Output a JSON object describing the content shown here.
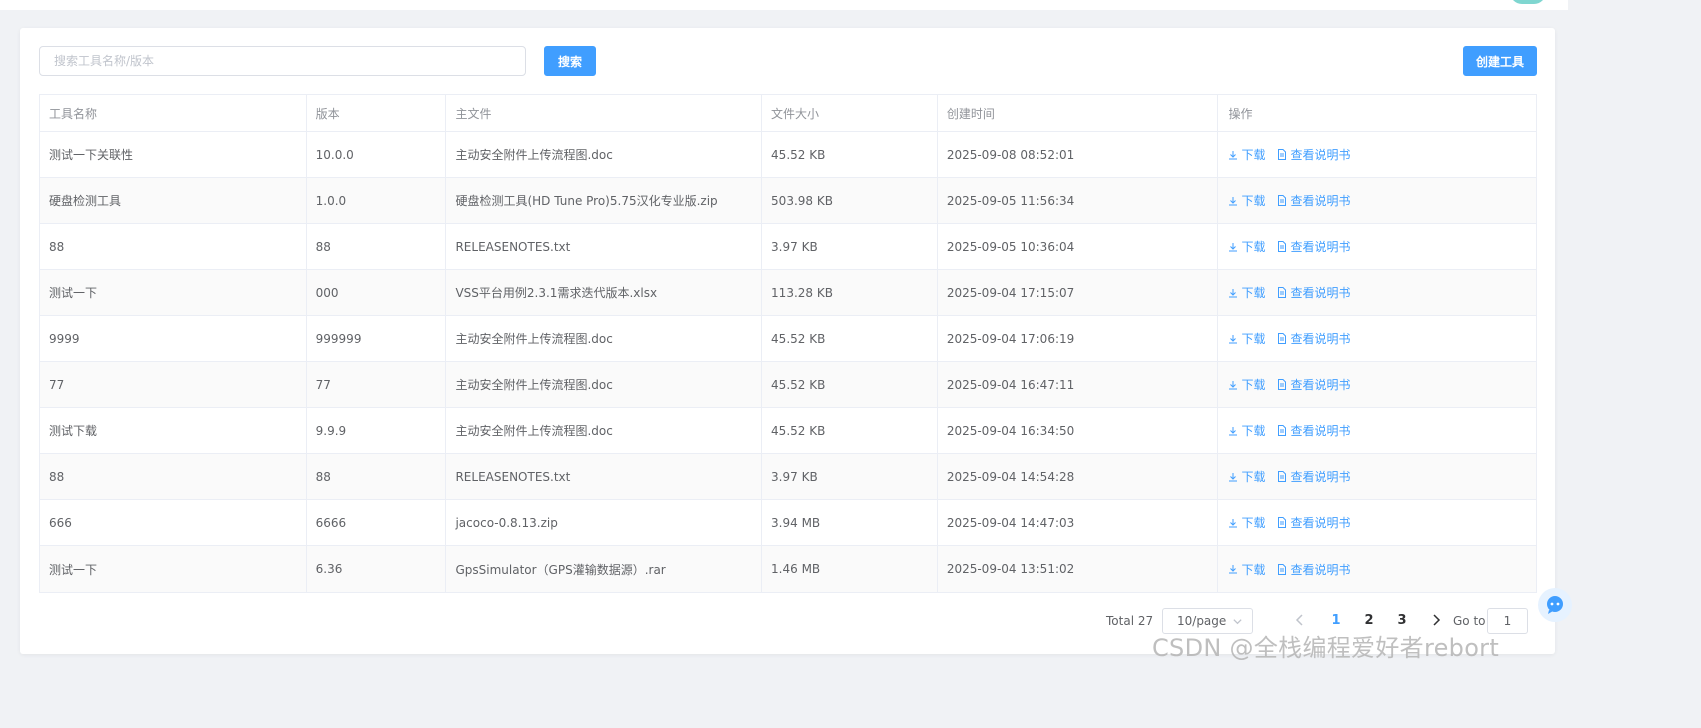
{
  "toolbar": {
    "search_placeholder": "搜索工具名称/版本",
    "search_value": "",
    "search_label": "搜索",
    "create_label": "创建工具"
  },
  "table": {
    "headers": [
      "工具名称",
      "版本",
      "主文件",
      "文件大小",
      "创建时间",
      "操作"
    ],
    "rows": [
      {
        "name": "测试一下关联性",
        "version": "10.0.0",
        "file": "主动安全附件上传流程图.doc",
        "size": "45.52 KB",
        "created": "2025-09-08 08:52:01"
      },
      {
        "name": "硬盘检测工具",
        "version": "1.0.0",
        "file": "硬盘检测工具(HD Tune Pro)5.75汉化专业版.zip",
        "size": "503.98 KB",
        "created": "2025-09-05 11:56:34"
      },
      {
        "name": "88",
        "version": "88",
        "file": "RELEASENOTES.txt",
        "size": "3.97 KB",
        "created": "2025-09-05 10:36:04"
      },
      {
        "name": "测试一下",
        "version": "000",
        "file": "VSS平台用例2.3.1需求迭代版本.xlsx",
        "size": "113.28 KB",
        "created": "2025-09-04 17:15:07"
      },
      {
        "name": "9999",
        "version": "999999",
        "file": "主动安全附件上传流程图.doc",
        "size": "45.52 KB",
        "created": "2025-09-04 17:06:19"
      },
      {
        "name": "77",
        "version": "77",
        "file": "主动安全附件上传流程图.doc",
        "size": "45.52 KB",
        "created": "2025-09-04 16:47:11"
      },
      {
        "name": "测试下载",
        "version": "9.9.9",
        "file": "主动安全附件上传流程图.doc",
        "size": "45.52 KB",
        "created": "2025-09-04 16:34:50"
      },
      {
        "name": "88",
        "version": "88",
        "file": "RELEASENOTES.txt",
        "size": "3.97 KB",
        "created": "2025-09-04 14:54:28"
      },
      {
        "name": "666",
        "version": "6666",
        "file": "jacoco-0.8.13.zip",
        "size": "3.94 MB",
        "created": "2025-09-04 14:47:03"
      },
      {
        "name": "测试一下",
        "version": "6.36",
        "file": "GpsSimulator（GPS灌输数据源）.rar",
        "size": "1.46 MB",
        "created": "2025-09-04 13:51:02"
      }
    ],
    "actions": {
      "download": "下载",
      "manual": "查看说明书"
    }
  },
  "pagination": {
    "total": "Total 27",
    "page_size": "10/page",
    "pages": [
      "1",
      "2",
      "3"
    ],
    "current": "1",
    "goto_label": "Go to",
    "goto_value": "1"
  },
  "watermark": "CSDN @全栈编程爱好者rebort",
  "colors": {
    "primary": "#409eff",
    "border": "#ebeef5",
    "header_text": "#909399"
  }
}
